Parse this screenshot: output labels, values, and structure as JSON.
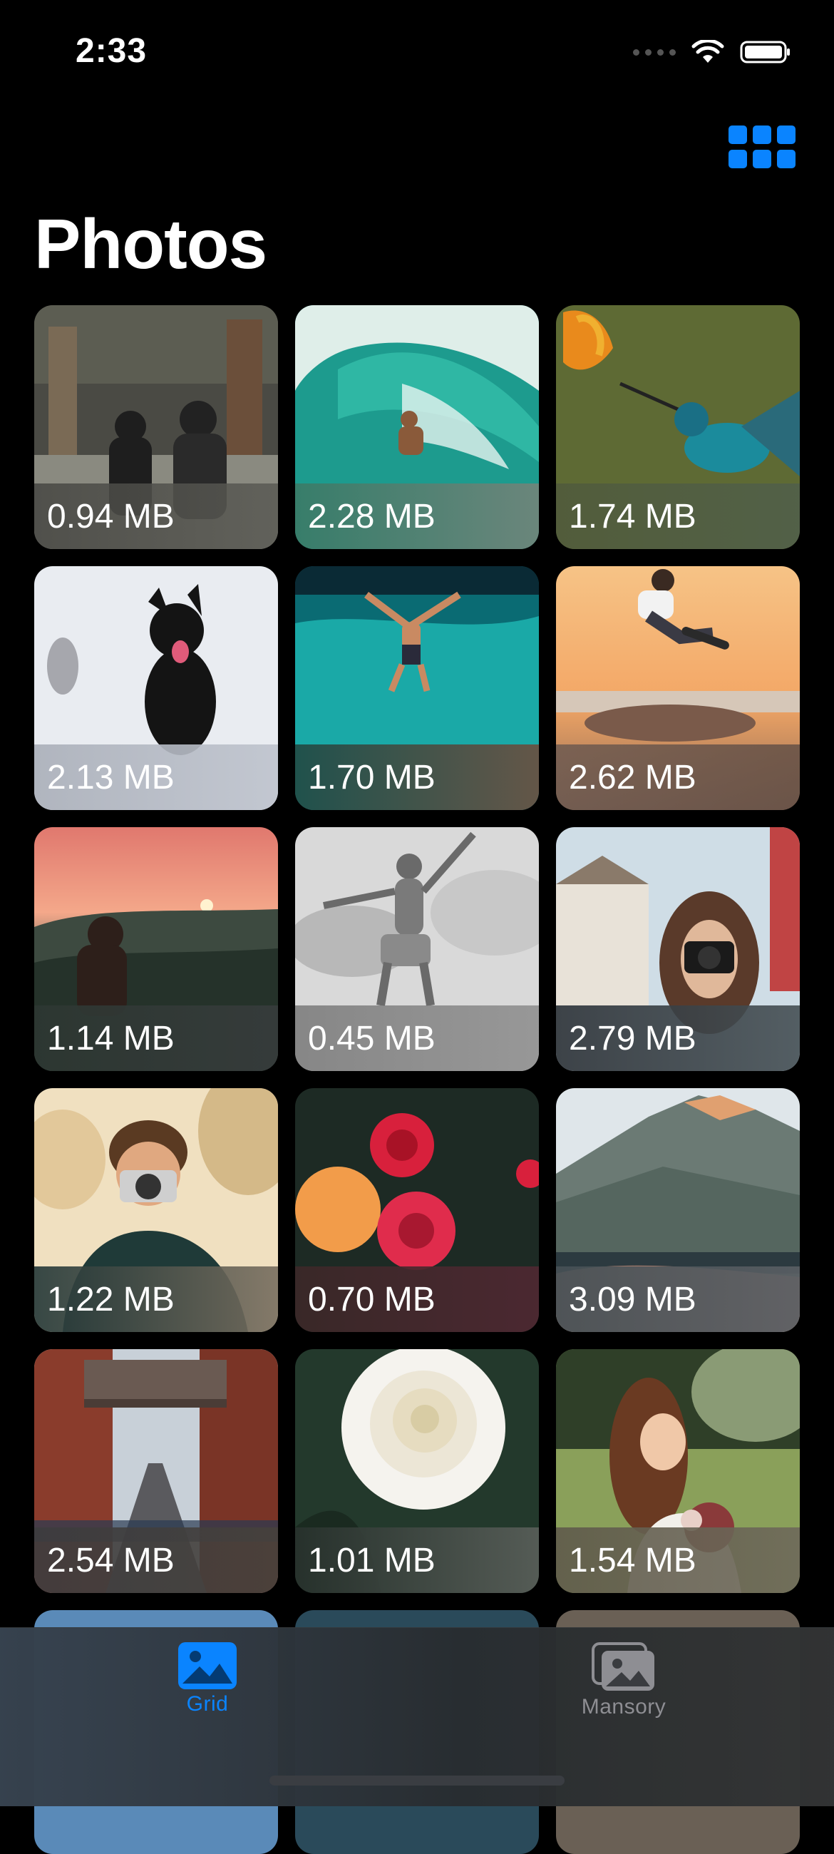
{
  "status_bar": {
    "time": "2:33"
  },
  "header": {
    "title": "Photos",
    "view_toggle_icon": "grid-icon"
  },
  "photos": [
    {
      "label": "0.94 MB",
      "subject": "street-people"
    },
    {
      "label": "2.28 MB",
      "subject": "surfer-wave"
    },
    {
      "label": "1.74 MB",
      "subject": "hummingbird"
    },
    {
      "label": "2.13 MB",
      "subject": "dog-snow"
    },
    {
      "label": "1.70 MB",
      "subject": "diver-water"
    },
    {
      "label": "2.62 MB",
      "subject": "skateboarder-sunset"
    },
    {
      "label": "1.14 MB",
      "subject": "woman-sunset"
    },
    {
      "label": "0.45 MB",
      "subject": "jumping-man"
    },
    {
      "label": "2.79 MB",
      "subject": "woman-camera"
    },
    {
      "label": "1.22 MB",
      "subject": "boy-camera"
    },
    {
      "label": "0.70 MB",
      "subject": "red-flowers"
    },
    {
      "label": "3.09 MB",
      "subject": "mountains"
    },
    {
      "label": "2.54 MB",
      "subject": "city-street-bridge"
    },
    {
      "label": "1.01 MB",
      "subject": "white-rose"
    },
    {
      "label": "1.54 MB",
      "subject": "bride-bouquet"
    }
  ],
  "tab_bar": {
    "tabs": [
      {
        "label": "Grid",
        "icon": "photo-icon",
        "active": true
      },
      {
        "label": "Mansory",
        "icon": "photo-stack-icon",
        "active": false
      }
    ]
  },
  "colors": {
    "accent": "#0A84FF",
    "inactive": "#8E8E93",
    "background": "#000000"
  }
}
